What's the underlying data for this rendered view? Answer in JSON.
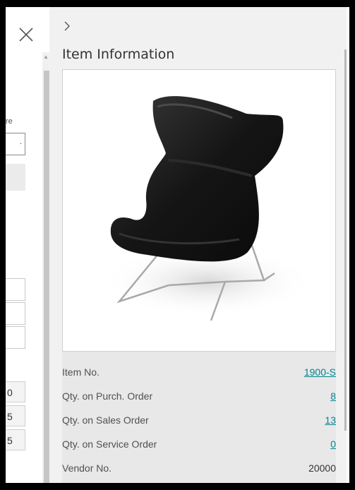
{
  "left_dialog": {
    "fragment_text": "re",
    "fragment_input_value": ".",
    "fragment_numbers": [
      "0",
      "5",
      "5"
    ]
  },
  "factbox": {
    "title": "Item Information",
    "picture_alt": "black lounge chair",
    "fields": [
      {
        "label": "Item No.",
        "value": "1900-S",
        "link": true
      },
      {
        "label": "Qty. on Purch. Order",
        "value": "8",
        "link": true
      },
      {
        "label": "Qty. on Sales Order",
        "value": "13",
        "link": true
      },
      {
        "label": "Qty. on Service Order",
        "value": "0",
        "link": true
      },
      {
        "label": "Vendor No.",
        "value": "20000",
        "link": false
      }
    ]
  },
  "colors": {
    "link": "#00838f",
    "pane_bg": "#f1f1f1",
    "frame": "#000000"
  },
  "icons": {
    "close": "close-icon",
    "collapse": "chevron-right-icon"
  }
}
